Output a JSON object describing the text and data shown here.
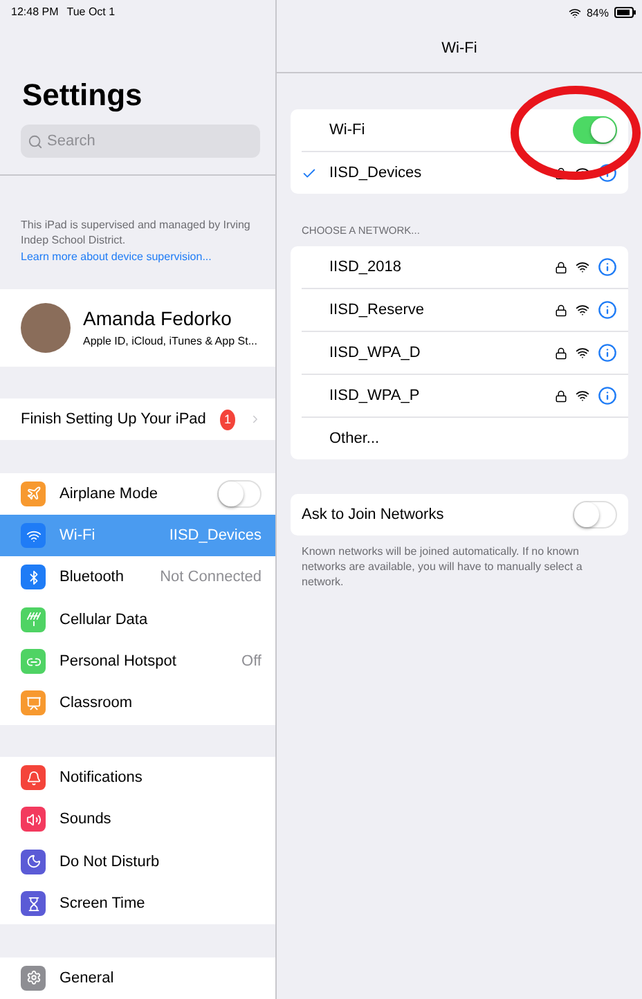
{
  "status_bar": {
    "time": "12:48 PM",
    "date": "Tue Oct 1",
    "battery": "84%"
  },
  "sidebar": {
    "title": "Settings",
    "search": {
      "placeholder": "Search"
    },
    "supervision_note": {
      "text": "This iPad is supervised and managed by Irving Indep School District.",
      "link": "Learn more about device supervision..."
    },
    "profile": {
      "name": "Amanda Fedorko",
      "subtitle": "Apple ID, iCloud, iTunes & App St..."
    },
    "setup_row": {
      "label": "Finish Setting Up Your iPad",
      "badge": "1"
    },
    "groups": [
      [
        {
          "kind": "toggle",
          "label": "Airplane Mode",
          "on": false,
          "selected": false,
          "color": "#f7992f"
        },
        {
          "kind": "detail",
          "label": "Wi-Fi",
          "value": "IISD_Devices",
          "selected": true,
          "color": "#1f7cf6"
        },
        {
          "kind": "detail",
          "label": "Bluetooth",
          "value": "Not Connected",
          "selected": false,
          "color": "#1f7cf6"
        },
        {
          "kind": "plain",
          "label": "Cellular Data",
          "selected": false,
          "color": "#4fd364"
        },
        {
          "kind": "detail",
          "label": "Personal Hotspot",
          "value": "Off",
          "selected": false,
          "color": "#4fd364"
        },
        {
          "kind": "plain",
          "label": "Classroom",
          "selected": false,
          "color": "#f7992f"
        }
      ],
      [
        {
          "kind": "plain",
          "label": "Notifications",
          "selected": false,
          "color": "#f4443a"
        },
        {
          "kind": "plain",
          "label": "Sounds",
          "selected": false,
          "color": "#f33a5e"
        },
        {
          "kind": "plain",
          "label": "Do Not Disturb",
          "selected": false,
          "color": "#5b5bd6"
        },
        {
          "kind": "plain",
          "label": "Screen Time",
          "selected": false,
          "color": "#5b5bd6"
        }
      ],
      [
        {
          "kind": "plain",
          "label": "General",
          "selected": false,
          "color": "#8e8e93"
        }
      ]
    ]
  },
  "detail": {
    "title": "Wi-Fi",
    "wifi_toggle": {
      "label": "Wi-Fi",
      "on": true
    },
    "connected": {
      "name": "IISD_Devices",
      "checked": true
    },
    "networks_header": "CHOOSE A NETWORK...",
    "networks": [
      {
        "name": "IISD_2018",
        "secured": true
      },
      {
        "name": "IISD_Reserve",
        "secured": true
      },
      {
        "name": "IISD_WPA_D",
        "secured": true
      },
      {
        "name": "IISD_WPA_P",
        "secured": true
      }
    ],
    "other": "Other...",
    "ask_to_join": {
      "label": "Ask to Join Networks",
      "on": false
    },
    "footnote": "Known networks will be joined automatically. If no known networks are available, you will have to manually select a network."
  }
}
